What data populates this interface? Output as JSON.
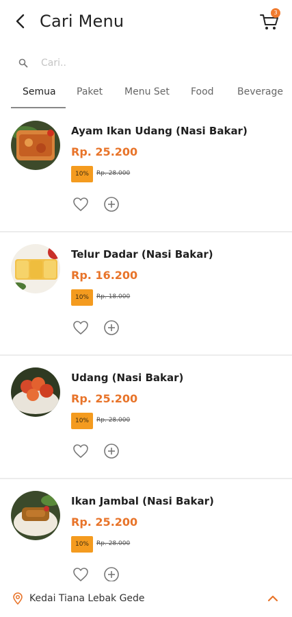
{
  "header": {
    "title": "Cari Menu",
    "cart_count": "3"
  },
  "search": {
    "placeholder": "Cari.."
  },
  "tabs": [
    {
      "label": "Semua",
      "active": true
    },
    {
      "label": "Paket",
      "active": false
    },
    {
      "label": "Menu Set",
      "active": false
    },
    {
      "label": "Food",
      "active": false
    },
    {
      "label": "Beverage",
      "active": false
    }
  ],
  "menu": [
    {
      "name": "Ayam Ikan Udang (Nasi Bakar)",
      "price": "Rp. 25.200",
      "discount": "10%",
      "original_price": "Rp. 28.000"
    },
    {
      "name": "Telur Dadar (Nasi Bakar)",
      "price": "Rp. 16.200",
      "discount": "10%",
      "original_price": "Rp. 18.000"
    },
    {
      "name": "Udang (Nasi Bakar)",
      "price": "Rp. 25.200",
      "discount": "10%",
      "original_price": "Rp. 28.000"
    },
    {
      "name": "Ikan Jambal (Nasi Bakar)",
      "price": "Rp. 25.200",
      "discount": "10%",
      "original_price": "Rp. 28.000"
    }
  ],
  "footer": {
    "store_name": "Kedai Tiana Lebak Gede"
  },
  "colors": {
    "accent": "#e8742a",
    "badge": "#f49b1f",
    "divider": "#ececec"
  }
}
